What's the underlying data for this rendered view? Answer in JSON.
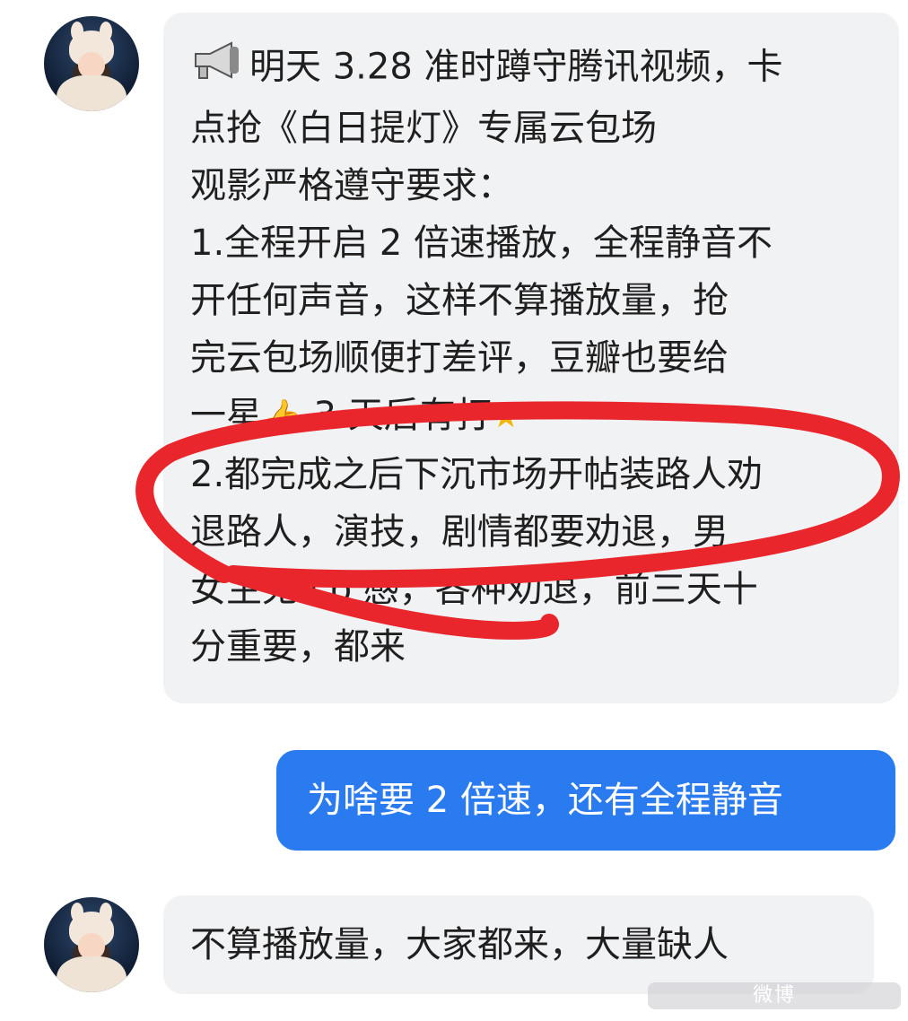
{
  "messages": [
    {
      "sender": "other",
      "lines": [
        "明天 3.28 准时蹲守腾讯视频，卡",
        "点抢《白日提灯》专属云包场",
        "观影严格遵守要求：",
        "1.全程开启 2 倍速播放，全程静音不",
        "开任何声音，这样不算播放量，抢",
        "完云包场顺便打差评，豆瓣也要给",
        "一星",
        "2.都完成之后下沉市场开帖装路人劝",
        "退路人，演技，剧情都要劝退，男",
        "女主无 cp 感，各种劝退，前三天十",
        "分重要，都来"
      ],
      "line_7_tail": "3 天后有打"
    },
    {
      "sender": "me",
      "text": "为啥要 2 倍速，还有全程静音"
    },
    {
      "sender": "other",
      "text": "不算播放量，大家都来，大量缺人"
    }
  ],
  "icons": {
    "megaphone": "megaphone-icon",
    "thumbs_up": "thumbs-up-emoji",
    "star": "star-emoji"
  },
  "colors": {
    "incoming_bubble": "#f1f2f4",
    "outgoing_bubble": "#2a7bf0",
    "annotation_red": "#e8262b"
  },
  "watermark": "微博"
}
